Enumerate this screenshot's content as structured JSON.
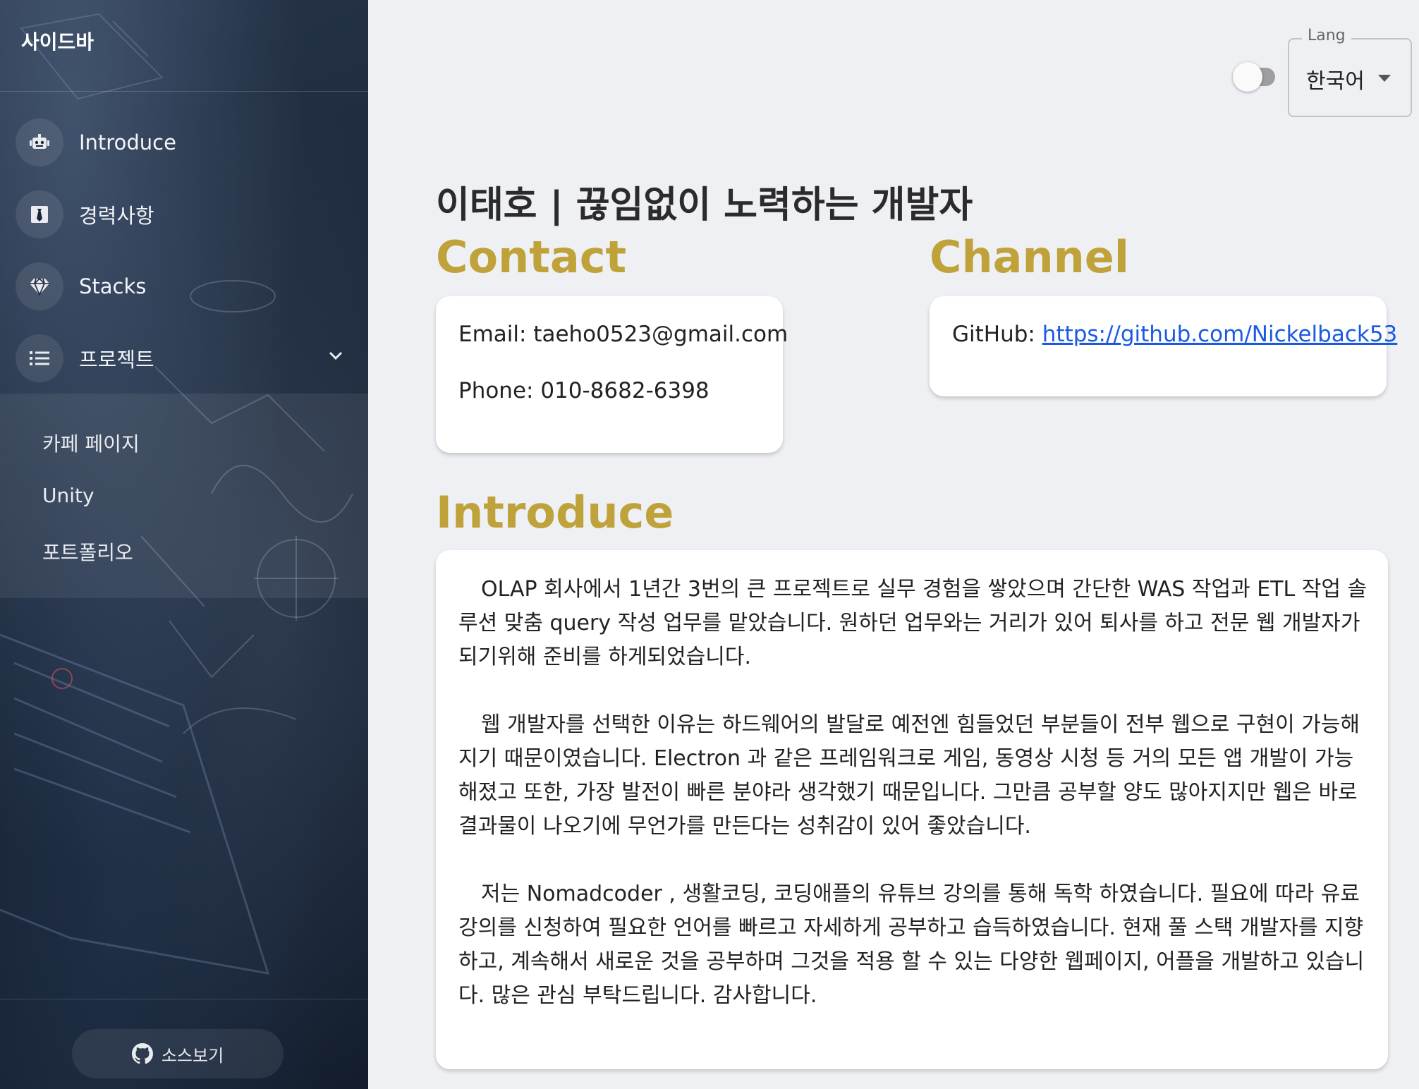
{
  "sidebar": {
    "title": "사이드바",
    "items": [
      {
        "label": "Introduce",
        "icon": "robot-icon"
      },
      {
        "label": "경력사항",
        "icon": "tie-icon"
      },
      {
        "label": "Stacks",
        "icon": "gem-icon"
      },
      {
        "label": "프로젝트",
        "icon": "list-icon",
        "expanded": true
      }
    ],
    "submenu": [
      "카페 페이지",
      "Unity",
      "포트폴리오"
    ],
    "source_button": "소스보기"
  },
  "toolbar": {
    "dark_mode": false,
    "lang_label": "Lang",
    "lang_value": "한국어"
  },
  "main": {
    "title": "이태호 | 끊임없이 노력하는 개발자",
    "contact": {
      "heading": "Contact",
      "email": "Email: taeho0523@gmail.com",
      "phone": "Phone: 010-8682-6398"
    },
    "channel": {
      "heading": "Channel",
      "github_label": "GitHub: ",
      "github_url": "https://github.com/Nickelback53"
    },
    "introduce": {
      "heading": "Introduce",
      "paragraphs": [
        "OLAP 회사에서 1년간 3번의 큰 프로젝트로 실무 경험을 쌓았으며 간단한 WAS 작업과 ETL 작업 솔루션 맞춤 query 작성 업무를 맡았습니다. 원하던 업무와는 거리가 있어 퇴사를 하고 전문 웹 개발자가 되기위해 준비를 하게되었습니다.",
        "웹 개발자를 선택한 이유는 하드웨어의 발달로 예전엔 힘들었던 부분들이 전부 웹으로 구현이 가능해지기 때문이였습니다. Electron 과 같은 프레임워크로 게임,  동영상 시청 등 거의 모든 앱 개발이 가능해졌고 또한, 가장 발전이 빠른 분야라 생각했기 때문입니다. 그만큼 공부할 양도 많아지지만 웹은 바로 결과물이 나오기에 무언가를 만든다는 성취감이 있어 좋았습니다.",
        "저는 Nomadcoder , 생활코딩, 코딩애플의 유튜브 강의를 통해 독학 하였습니다. 필요에 따라 유료 강의를 신청하여 필요한 언어를 빠르고 자세하게 공부하고 습득하였습니다. 현재 풀 스택 개발자를 지향하고, 계속해서 새로운 것을 공부하며 그것을 적용 할 수 있는 다양한 웹페이지, 어플을 개발하고 있습니다. 많은 관심 부탁드립니다. 감사합니다."
      ]
    }
  },
  "colors": {
    "accent": "#bfa23a",
    "link": "#1a5ae0",
    "background": "#eff0f4"
  }
}
